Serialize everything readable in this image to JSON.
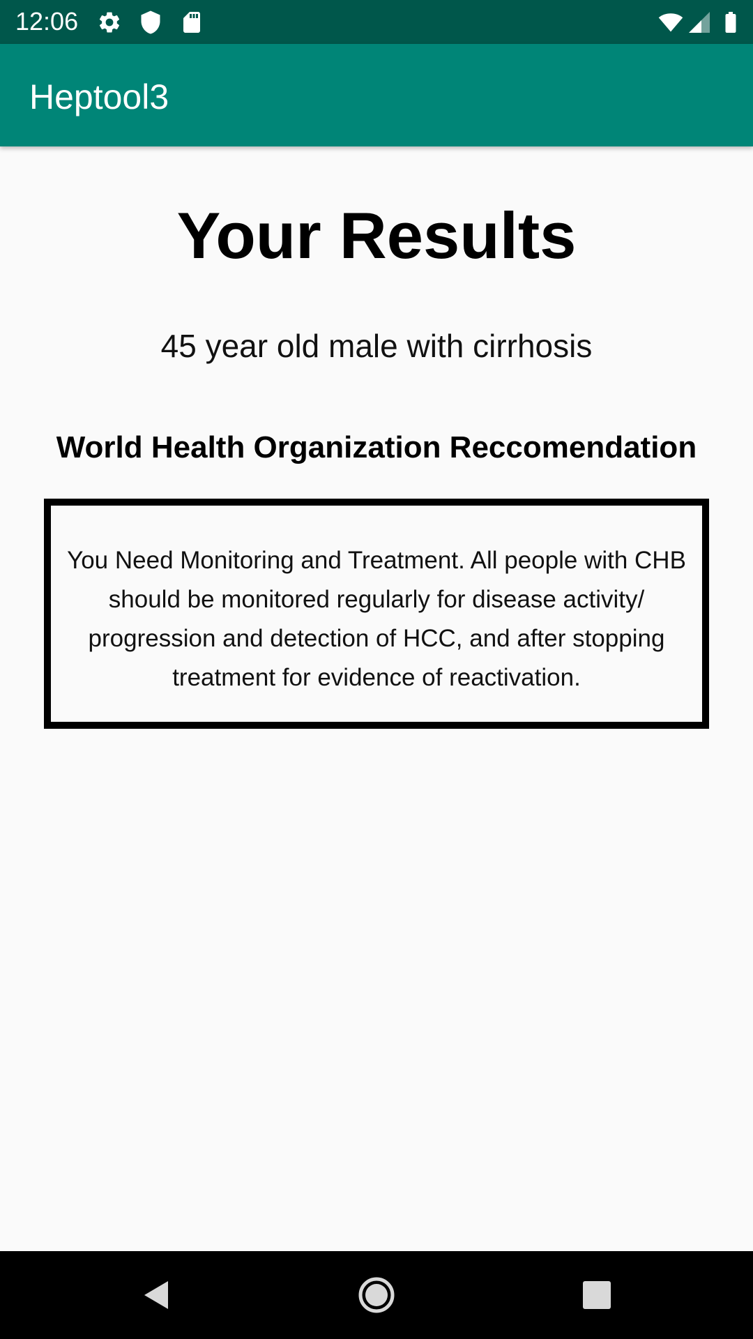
{
  "status_bar": {
    "time": "12:06",
    "icons_left": [
      "settings-icon",
      "shield-icon",
      "sd-card-icon"
    ],
    "icons_right": [
      "wifi-icon",
      "cell-signal-icon",
      "battery-icon"
    ],
    "background": "#00574b"
  },
  "app_bar": {
    "title": "Heptool3",
    "background": "#008577"
  },
  "content": {
    "results_title": "Your Results",
    "patient_summary": "45 year old male with cirrhosis",
    "recommendation_heading": "World Health Organization Reccomendation",
    "recommendation_text": "You Need Monitoring and Treatment. All people with CHB should be monitored regularly for disease activity/ progression and detection of HCC, and after stopping treatment for evidence of reactivation."
  },
  "nav_bar": {
    "buttons": [
      "back-icon",
      "home-icon",
      "recents-icon"
    ]
  }
}
